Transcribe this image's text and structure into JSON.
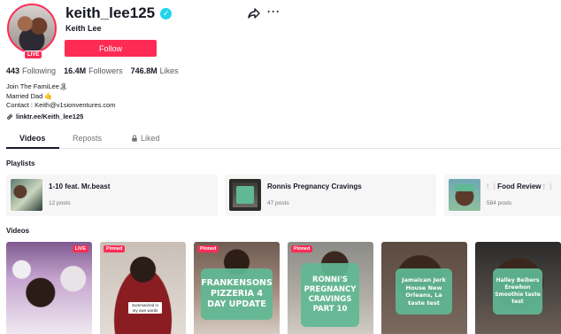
{
  "profile": {
    "username": "keith_lee125",
    "display_name": "Keith Lee",
    "live_label": "LIVE",
    "follow_label": "Follow",
    "stats": [
      {
        "value": "443",
        "label": "Following"
      },
      {
        "value": "16.4M",
        "label": "Followers"
      },
      {
        "value": "746.8M",
        "label": "Likes"
      }
    ],
    "bio": [
      "Join The FamiLee🏝",
      "Married Dad 🤙",
      "Contact : Keith@v1sionventures.com"
    ],
    "link": "linktr.ee/Keith_lee125"
  },
  "tabs": [
    {
      "label": "Videos",
      "active": true
    },
    {
      "label": "Reposts",
      "active": false
    },
    {
      "label": "Liked",
      "active": false,
      "icon": "lock-icon"
    }
  ],
  "playlists_title": "Playlists",
  "playlists": [
    {
      "title": "1-10 feat. Mr.beast",
      "count": "12 posts"
    },
    {
      "title": "Ronnis Pregnancy Cravings",
      "count": "47 posts"
    },
    {
      "title": "🍽️ Food Review 🍽️",
      "count": "584 posts"
    }
  ],
  "videos_title": "Videos",
  "videos": [
    {
      "badge": "LIVE",
      "card": "",
      "caption": ""
    },
    {
      "badge": "Pinned",
      "card": "",
      "caption": "Summarized in my own words"
    },
    {
      "badge": "Pinned",
      "card": "FRANKENSONS PIZZERIA 4 DAY UPDATE",
      "caption": ""
    },
    {
      "badge": "Pinned",
      "card": "RONNI'S PREGNANCY CRAVINGS PART 10",
      "caption": ""
    },
    {
      "badge": "",
      "card": "Jamaican Jerk House New Orleans, La taste test",
      "caption": ""
    },
    {
      "badge": "",
      "card": "Halley Beibers Erewhon Smoothie taste test",
      "caption": ""
    }
  ],
  "colors": {
    "accent": "#fe2c55",
    "verified": "#20d5ec",
    "card_green": "#60b894"
  }
}
